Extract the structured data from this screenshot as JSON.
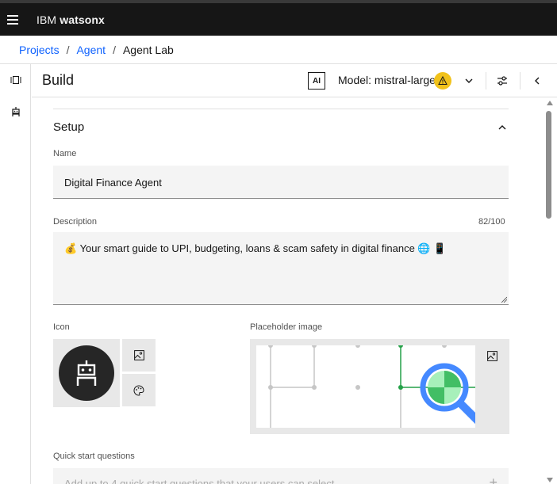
{
  "header": {
    "brand_prefix": "IBM",
    "brand_name": "watsonx"
  },
  "breadcrumb": {
    "items": [
      "Projects",
      "Agent"
    ],
    "separator": "/",
    "current": "Agent Lab"
  },
  "build": {
    "title": "Build",
    "ai_badge": "AI",
    "model_label": "Model: mistral-large",
    "warning_icon": "warning-icon",
    "accent_color": "#f1c21b"
  },
  "setup": {
    "title": "Setup",
    "name_label": "Name",
    "name_value": "Digital Finance Agent",
    "description_label": "Description",
    "description_counter": "82/100",
    "description_value": "💰 Your smart guide to UPI, budgeting, loans & scam safety in digital finance 🌐 📱",
    "icon_label": "Icon",
    "placeholder_image_label": "Placeholder image",
    "quick_start_label": "Quick start questions",
    "quick_start_placeholder": "Add up to 4 quick start questions that your users can select",
    "quick_start_add": "+"
  },
  "colors": {
    "link": "#0f62fe",
    "topbar": "#161616",
    "graph_green": "#24a148",
    "magnifier_blue": "#4589ff"
  }
}
